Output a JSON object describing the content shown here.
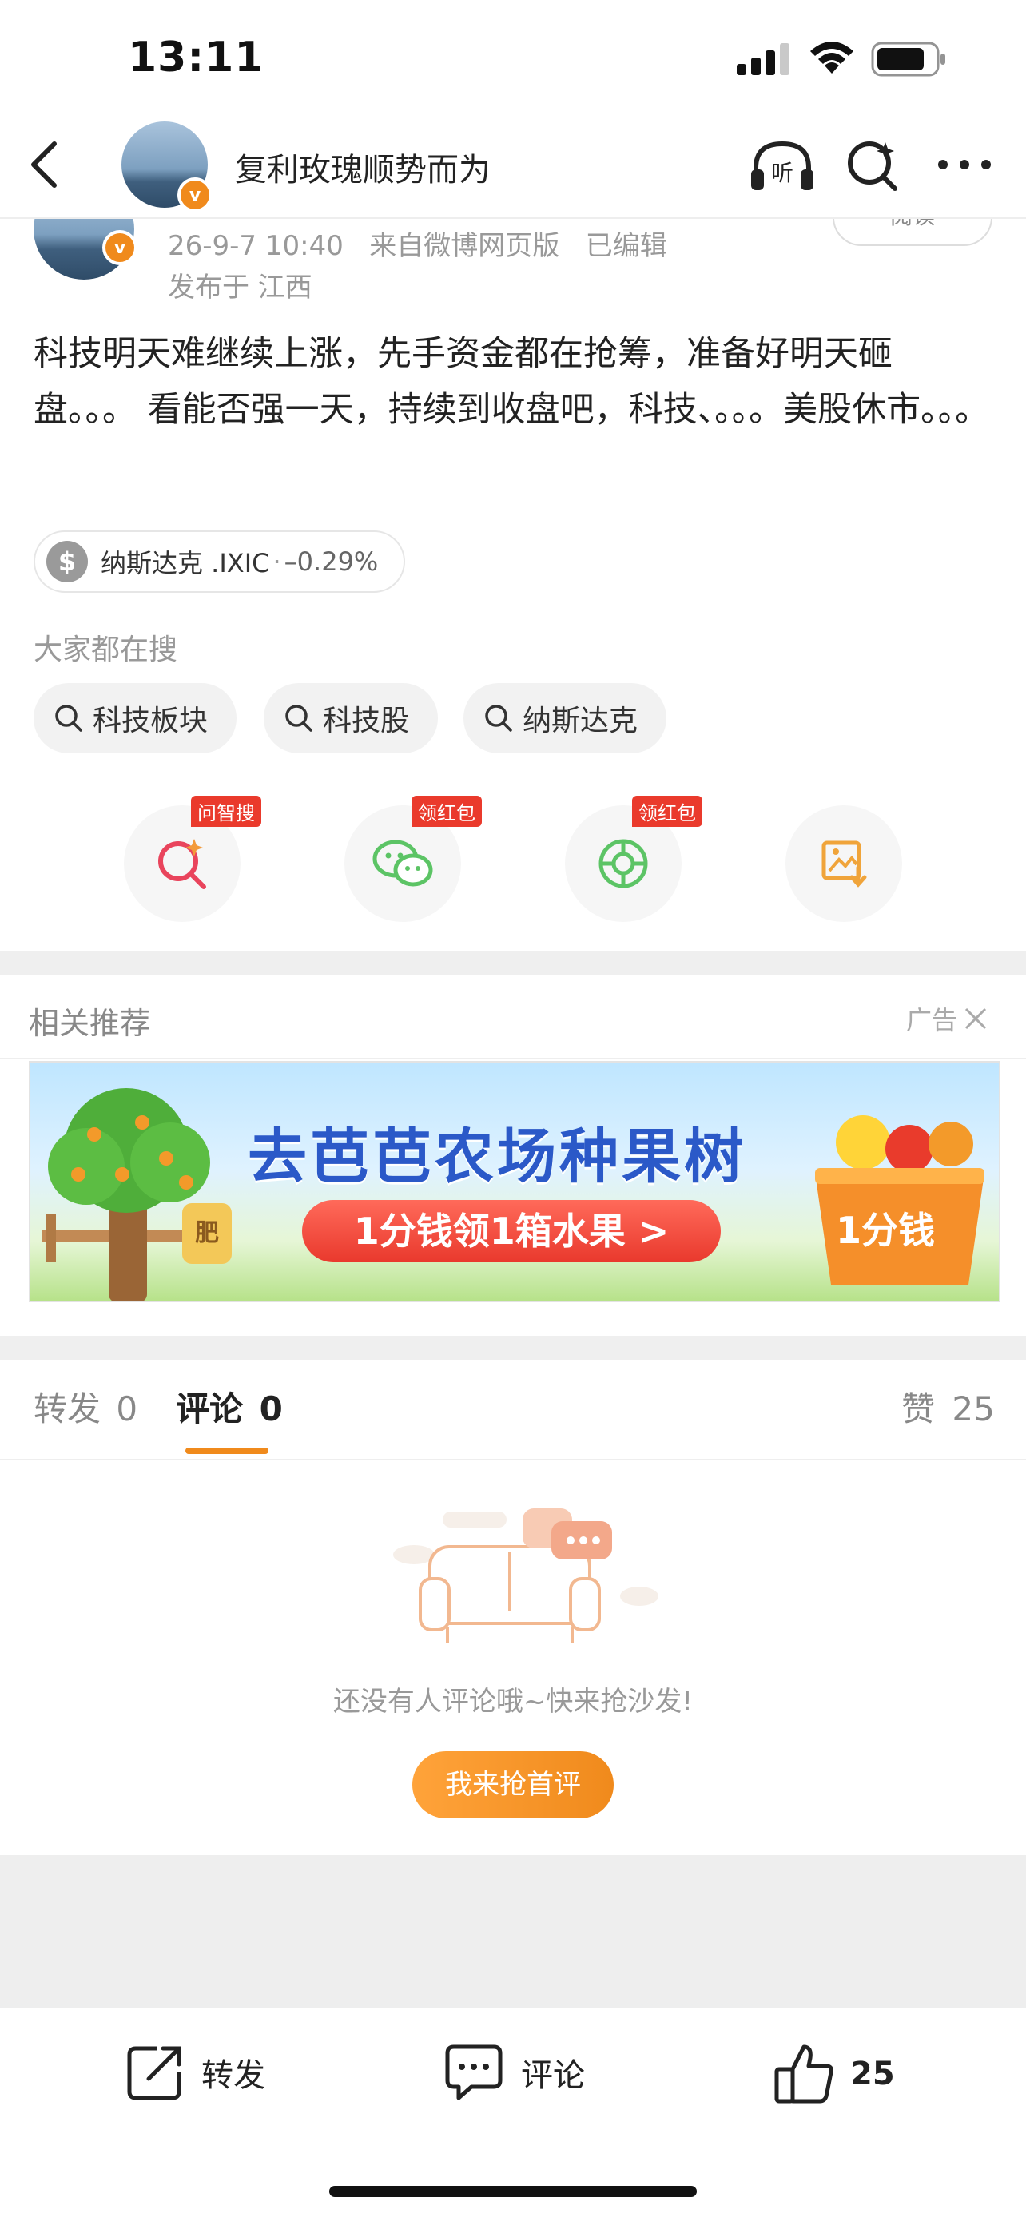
{
  "status_bar": {
    "time": "13:11"
  },
  "nav": {
    "title": "复利玫瑰顺势而为",
    "badge": "v"
  },
  "post": {
    "meta_time": "26-9-7 10:40",
    "meta_source": "来自微博网页版",
    "meta_edited": "已编辑",
    "location": "发布于 江西",
    "read_button": "阅读",
    "text": "科技明天难继续上涨，先手资金都在抢筹，准备好明天砸盘。。。 看能否强一天，持续到收盘吧，科技、。。。美股休市。。。"
  },
  "stock_chip": {
    "symbol": "$",
    "name": "纳斯达克 .IXIC",
    "sep": "·",
    "change": "–0.29%"
  },
  "searches": {
    "title": "大家都在搜",
    "items": [
      "科技板块",
      "科技股",
      "纳斯达克"
    ]
  },
  "actions": [
    {
      "icon": "ask-search-icon",
      "tag": "问智搜"
    },
    {
      "icon": "wechat-icon",
      "tag": "领红包"
    },
    {
      "icon": "moments-icon",
      "tag": "领红包"
    },
    {
      "icon": "save-image-icon",
      "tag": ""
    }
  ],
  "recommend": {
    "title": "相关推荐",
    "ad_label": "广告",
    "banner": {
      "headline": "去芭芭农场种果树",
      "cta": "1分钱领1箱水果 >",
      "badge": "1分钱",
      "sack_label": "肥"
    }
  },
  "tabs": {
    "repost": {
      "label": "转发",
      "count": "0"
    },
    "comment": {
      "label": "评论",
      "count": "0"
    },
    "like": {
      "label": "赞",
      "count": "25"
    }
  },
  "empty": {
    "message": "还没有人评论哦~快来抢沙发!",
    "button": "我来抢首评"
  },
  "bottom": {
    "repost": "转发",
    "comment": "评论",
    "like_count": "25"
  },
  "colors": {
    "accent": "#f08a1c",
    "tag_red": "#ea3a2c",
    "ad_blue": "#2b59c8"
  }
}
